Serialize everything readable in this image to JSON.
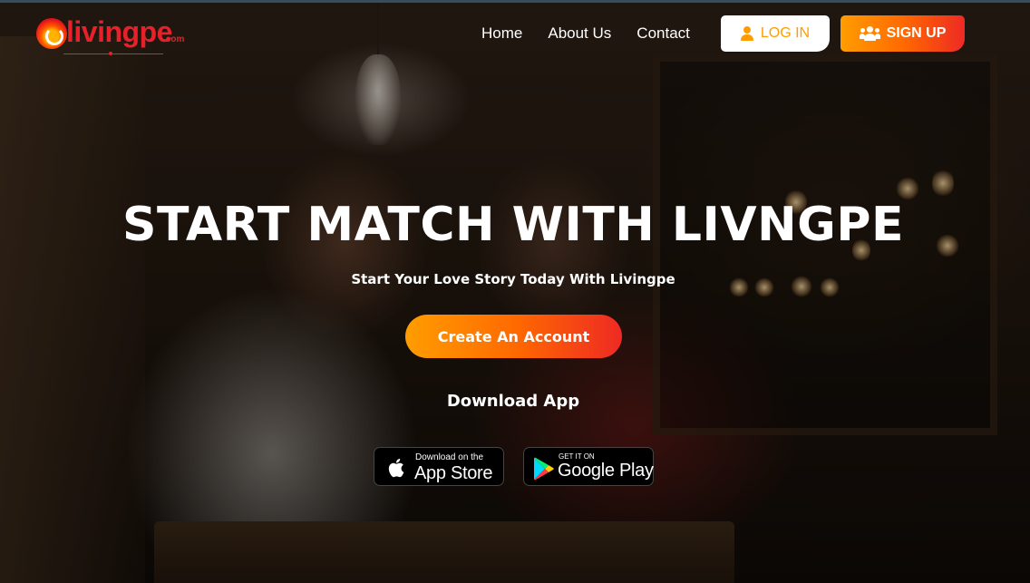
{
  "brand": {
    "name": "livingpe",
    "tld": ".com",
    "colors": {
      "primary": "#e8202a",
      "accent_orange": "#ff9d00",
      "gradient_end": "#ee2a24"
    }
  },
  "nav": {
    "items": [
      {
        "label": "Home"
      },
      {
        "label": "About Us"
      },
      {
        "label": "Contact"
      }
    ],
    "login_label": "LOG IN",
    "signup_label": "SIGN UP"
  },
  "hero": {
    "title": "START MATCH WITH LIVNGPE",
    "subtitle": "Start Your Love Story Today With Livingpe",
    "cta_label": "Create An Account",
    "download_heading": "Download App"
  },
  "badges": {
    "app_store": {
      "small": "Download on the",
      "big": "App Store",
      "icon": "apple-icon"
    },
    "google_play": {
      "small": "GET IT ON",
      "big": "Google Play",
      "icon": "google-play-icon"
    }
  }
}
